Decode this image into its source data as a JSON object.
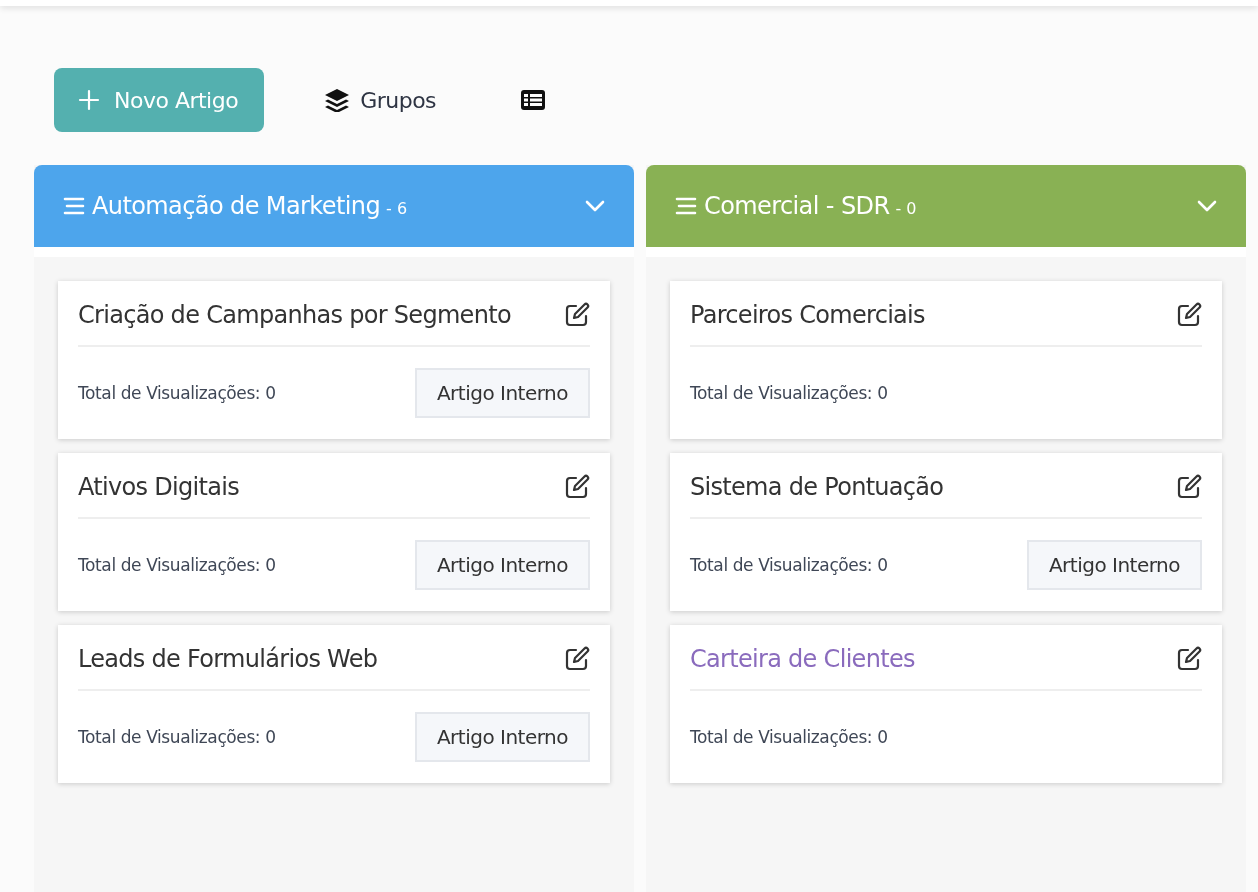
{
  "toolbar": {
    "new_button": "Novo Artigo",
    "groups_button": "Grupos"
  },
  "columns": [
    {
      "title": "Automação de Marketing",
      "count": "- 6",
      "color": "#4da5ec",
      "articles": [
        {
          "title": "Criação de Campanhas por Segmento",
          "views": "Total de Visualizações: 0",
          "tag": "Artigo Interno",
          "visited": false
        },
        {
          "title": "Ativos Digitais",
          "views": "Total de Visualizações: 0",
          "tag": "Artigo Interno",
          "visited": false
        },
        {
          "title": "Leads de Formulários Web",
          "views": "Total de Visualizações: 0",
          "tag": "Artigo Interno",
          "visited": false
        }
      ]
    },
    {
      "title": "Comercial - SDR",
      "count": "- 0",
      "color": "#89b154",
      "articles": [
        {
          "title": "Parceiros Comerciais",
          "views": "Total de Visualizações: 0",
          "visited": false
        },
        {
          "title": "Sistema de Pontuação",
          "views": "Total de Visualizações: 0",
          "tag": "Artigo Interno",
          "visited": false
        },
        {
          "title": "Carteira de Clientes",
          "views": "Total de Visualizações: 0",
          "visited": true
        }
      ]
    }
  ]
}
